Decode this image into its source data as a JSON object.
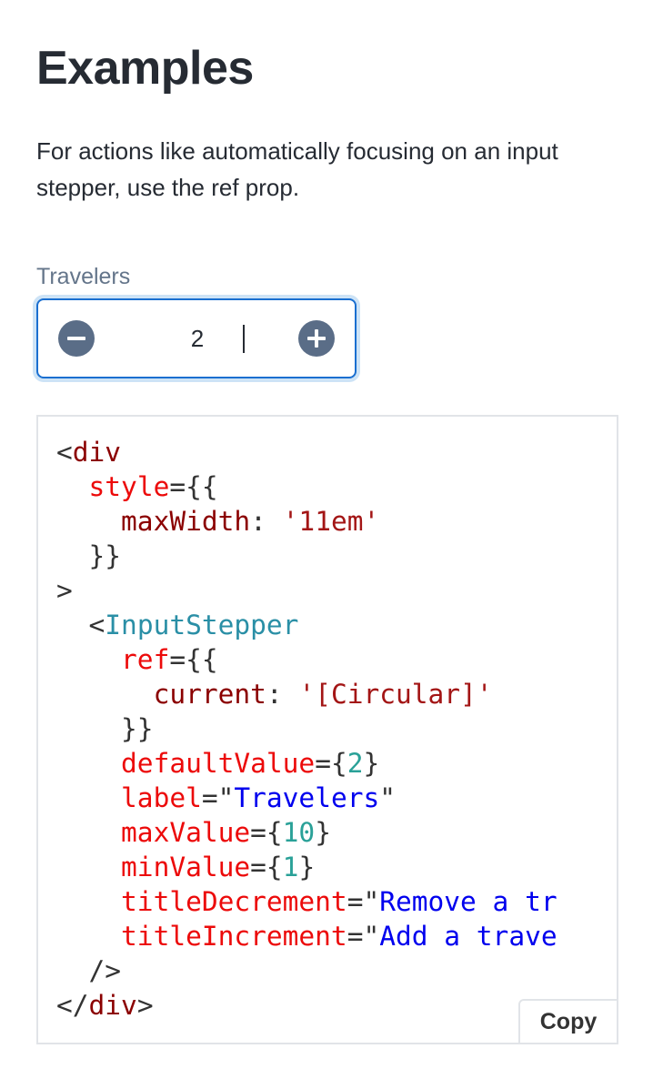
{
  "section": {
    "title": "Examples",
    "description": "For actions like automatically focusing on an input stepper, use the ref prop."
  },
  "stepper": {
    "label": "Travelers",
    "value": "2",
    "decrement_icon": "minus-circle-icon",
    "increment_icon": "plus-circle-icon"
  },
  "code_example": {
    "copy_label": "Copy",
    "tokens": {
      "lt": "<",
      "div": "div",
      "style_attr": "style",
      "eq_open_dbl": "={{",
      "max_width_key": "maxWidth",
      "colon": ":",
      "max_width_val": "'11em'",
      "close_dbl": "}}",
      "gt": ">",
      "component": "InputStepper",
      "ref_attr": "ref",
      "current_key": "current",
      "current_val": "'[Circular]'",
      "default_value_attr": "defaultValue",
      "default_value": "2",
      "label_attr": "label",
      "label_val": "Travelers",
      "max_value_attr": "maxValue",
      "max_value": "10",
      "min_value_attr": "minValue",
      "min_value": "1",
      "title_decrement_attr": "titleDecrement",
      "title_decrement_visible": "Remove a tr",
      "title_increment_attr": "titleIncrement",
      "title_increment_visible": "Add a trave",
      "self_close": "/>",
      "close_tag_open": "</",
      "eq": "=",
      "eq_brace": "={",
      "brace_close": "}",
      "quote": "\""
    }
  },
  "colors": {
    "accent": "#1a6fd0",
    "stepper_button": "#5a6d87",
    "label": "#64758a",
    "code_tag": "#8b0000",
    "code_component": "#2a8fa6",
    "code_attribute": "#ec0a0a",
    "code_string": "#0000ee",
    "code_number": "#2aa198"
  }
}
